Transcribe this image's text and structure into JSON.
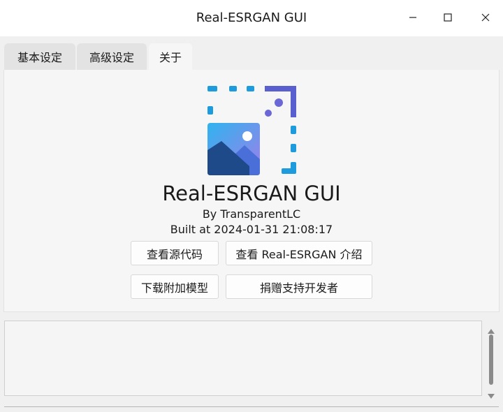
{
  "window": {
    "title": "Real-ESRGAN GUI",
    "controls": [
      "minimize-icon",
      "maximize-icon",
      "close-icon"
    ]
  },
  "tabs": [
    {
      "label": "基本设定",
      "active": false
    },
    {
      "label": "高级设定",
      "active": false
    },
    {
      "label": "关于",
      "active": true
    }
  ],
  "about": {
    "app_name": "Real-ESRGAN GUI",
    "author": "By TransparentLC",
    "built": "Built at 2024-01-31 21:08:17",
    "icon": "app-logo-image-icon",
    "buttons": {
      "source_code": "查看源代码",
      "intro": "查看 Real-ESRGAN 介绍",
      "download_models": "下载附加模型",
      "donate": "捐赠支持开发者"
    }
  },
  "log": {
    "text": ""
  },
  "colors": {
    "icon_blue": "#1e9bdc",
    "icon_purple": "#5a5fd0",
    "icon_dark_blue": "#1f3a78"
  }
}
